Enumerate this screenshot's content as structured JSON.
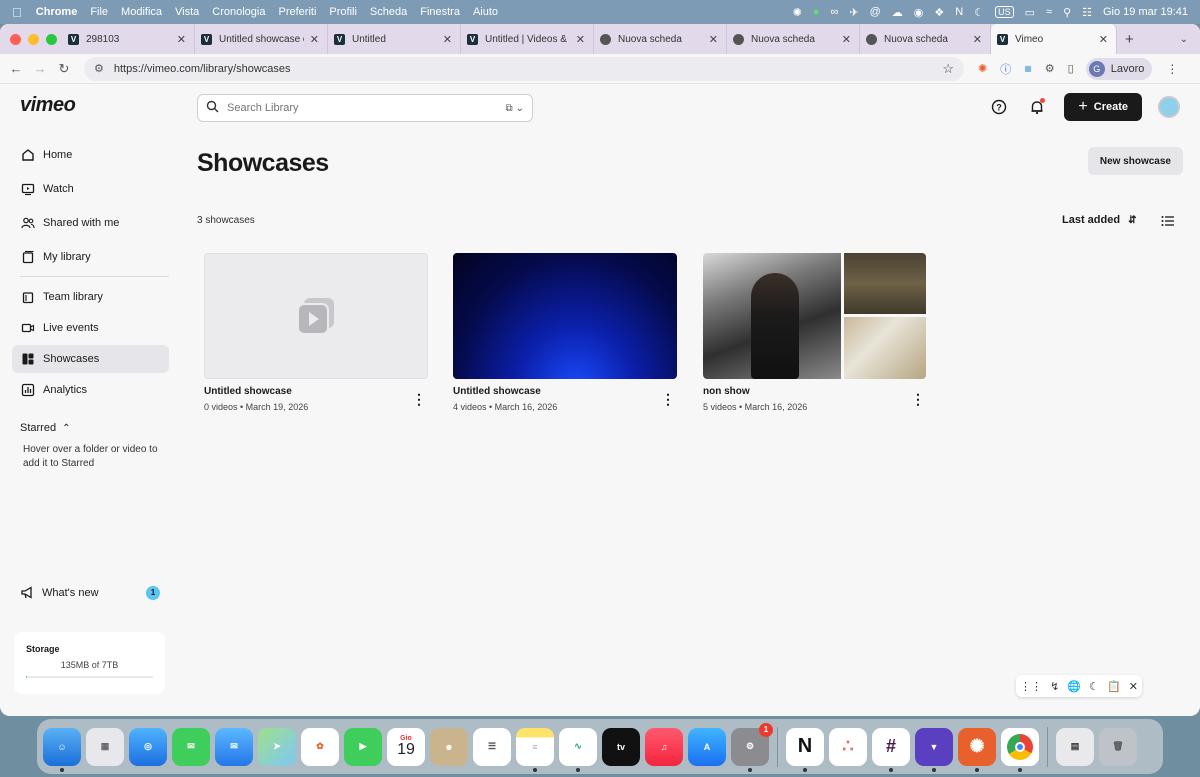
{
  "menubar": {
    "app": "Chrome",
    "items": [
      "File",
      "Modifica",
      "Vista",
      "Cronologia",
      "Preferiti",
      "Profili",
      "Scheda",
      "Finestra",
      "Aiuto"
    ],
    "keyboard": "US",
    "datetime": "Gio 19 mar  19:41"
  },
  "tabs": [
    {
      "title": "298103",
      "favicon": "V"
    },
    {
      "title": "Untitled showcase on",
      "favicon": "V"
    },
    {
      "title": "Untitled",
      "favicon": "V"
    },
    {
      "title": "Untitled | Videos & M",
      "favicon": "V"
    },
    {
      "title": "Nuova scheda",
      "favicon": "chrome-icon"
    },
    {
      "title": "Nuova scheda",
      "favicon": "chrome-icon"
    },
    {
      "title": "Nuova scheda",
      "favicon": "chrome-icon"
    },
    {
      "title": "Vimeo",
      "favicon": "V"
    }
  ],
  "address": {
    "url": "https://vimeo.com/library/showcases"
  },
  "profile": {
    "initial": "G",
    "name": "Lavoro"
  },
  "sidebar": {
    "logo": "vimeo",
    "items": [
      {
        "label": "Home",
        "icon": "home-icon"
      },
      {
        "label": "Watch",
        "icon": "play-icon"
      },
      {
        "label": "Shared with me",
        "icon": "people-icon"
      },
      {
        "label": "My library",
        "icon": "library-icon"
      },
      {
        "label": "Team library",
        "icon": "team-library-icon"
      },
      {
        "label": "Live events",
        "icon": "camera-icon"
      },
      {
        "label": "Showcases",
        "icon": "showcase-icon"
      },
      {
        "label": "Analytics",
        "icon": "analytics-icon"
      }
    ],
    "starred_label": "Starred",
    "starred_hint": "Hover over a folder or video to add it to Starred",
    "whats_new": "What's new",
    "whats_new_count": "1",
    "storage_label": "Storage",
    "storage_value": "135MB of 7TB",
    "storage_fraction": 0.0001
  },
  "search": {
    "placeholder": "Search Library"
  },
  "header": {
    "create": "Create"
  },
  "main": {
    "title": "Showcases",
    "new_button": "New showcase",
    "count": "3 showcases",
    "sort": "Last added",
    "cards": [
      {
        "title": "Untitled showcase",
        "meta": "0 videos • March 19, 2026"
      },
      {
        "title": "Untitled showcase",
        "meta": "4 videos • March 16, 2026"
      },
      {
        "title": "non show",
        "meta": "5 videos • March 16, 2026"
      }
    ]
  },
  "dock": {
    "calendar_month": "Gio",
    "calendar_day": "19",
    "settings_badge": "1",
    "tv_label": "tv"
  },
  "colors": {
    "accent": "#17d5ff",
    "create_bg": "#1a1a1a",
    "notify_dot": "#ee4b38"
  }
}
